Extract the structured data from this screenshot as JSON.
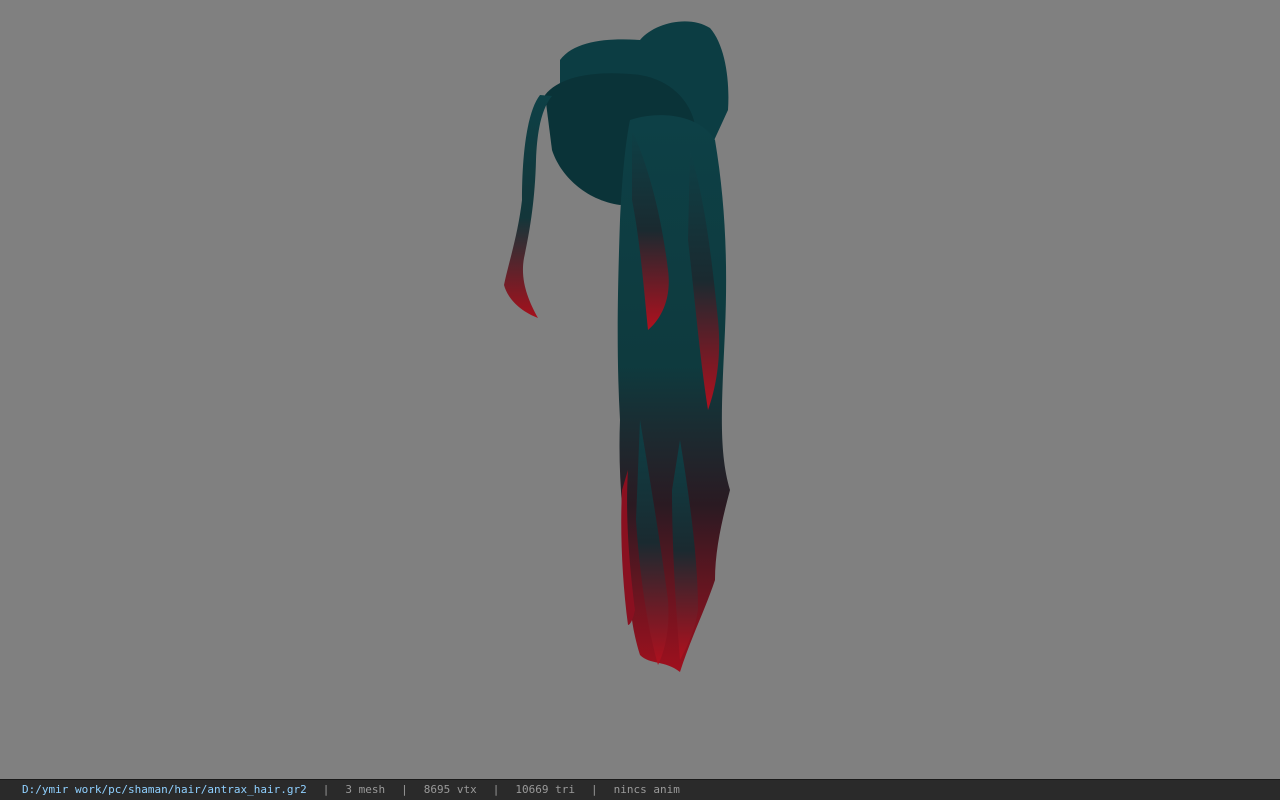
{
  "viewer": {
    "background_color": "#808080",
    "hair_color_top": "#0d4046",
    "hair_color_tip": "#a0101e"
  },
  "status_bar": {
    "file_path": "D:/ymir work/pc/shaman/hair/antrax_hair.gr2",
    "separator": "|",
    "mesh_count": "3 mesh",
    "vertex_count": "8695 vtx",
    "triangle_count": "10669 tri",
    "anim_status": "nincs anim",
    "path_color": "#8fd0ff",
    "text_color": "#9a9a9a"
  }
}
